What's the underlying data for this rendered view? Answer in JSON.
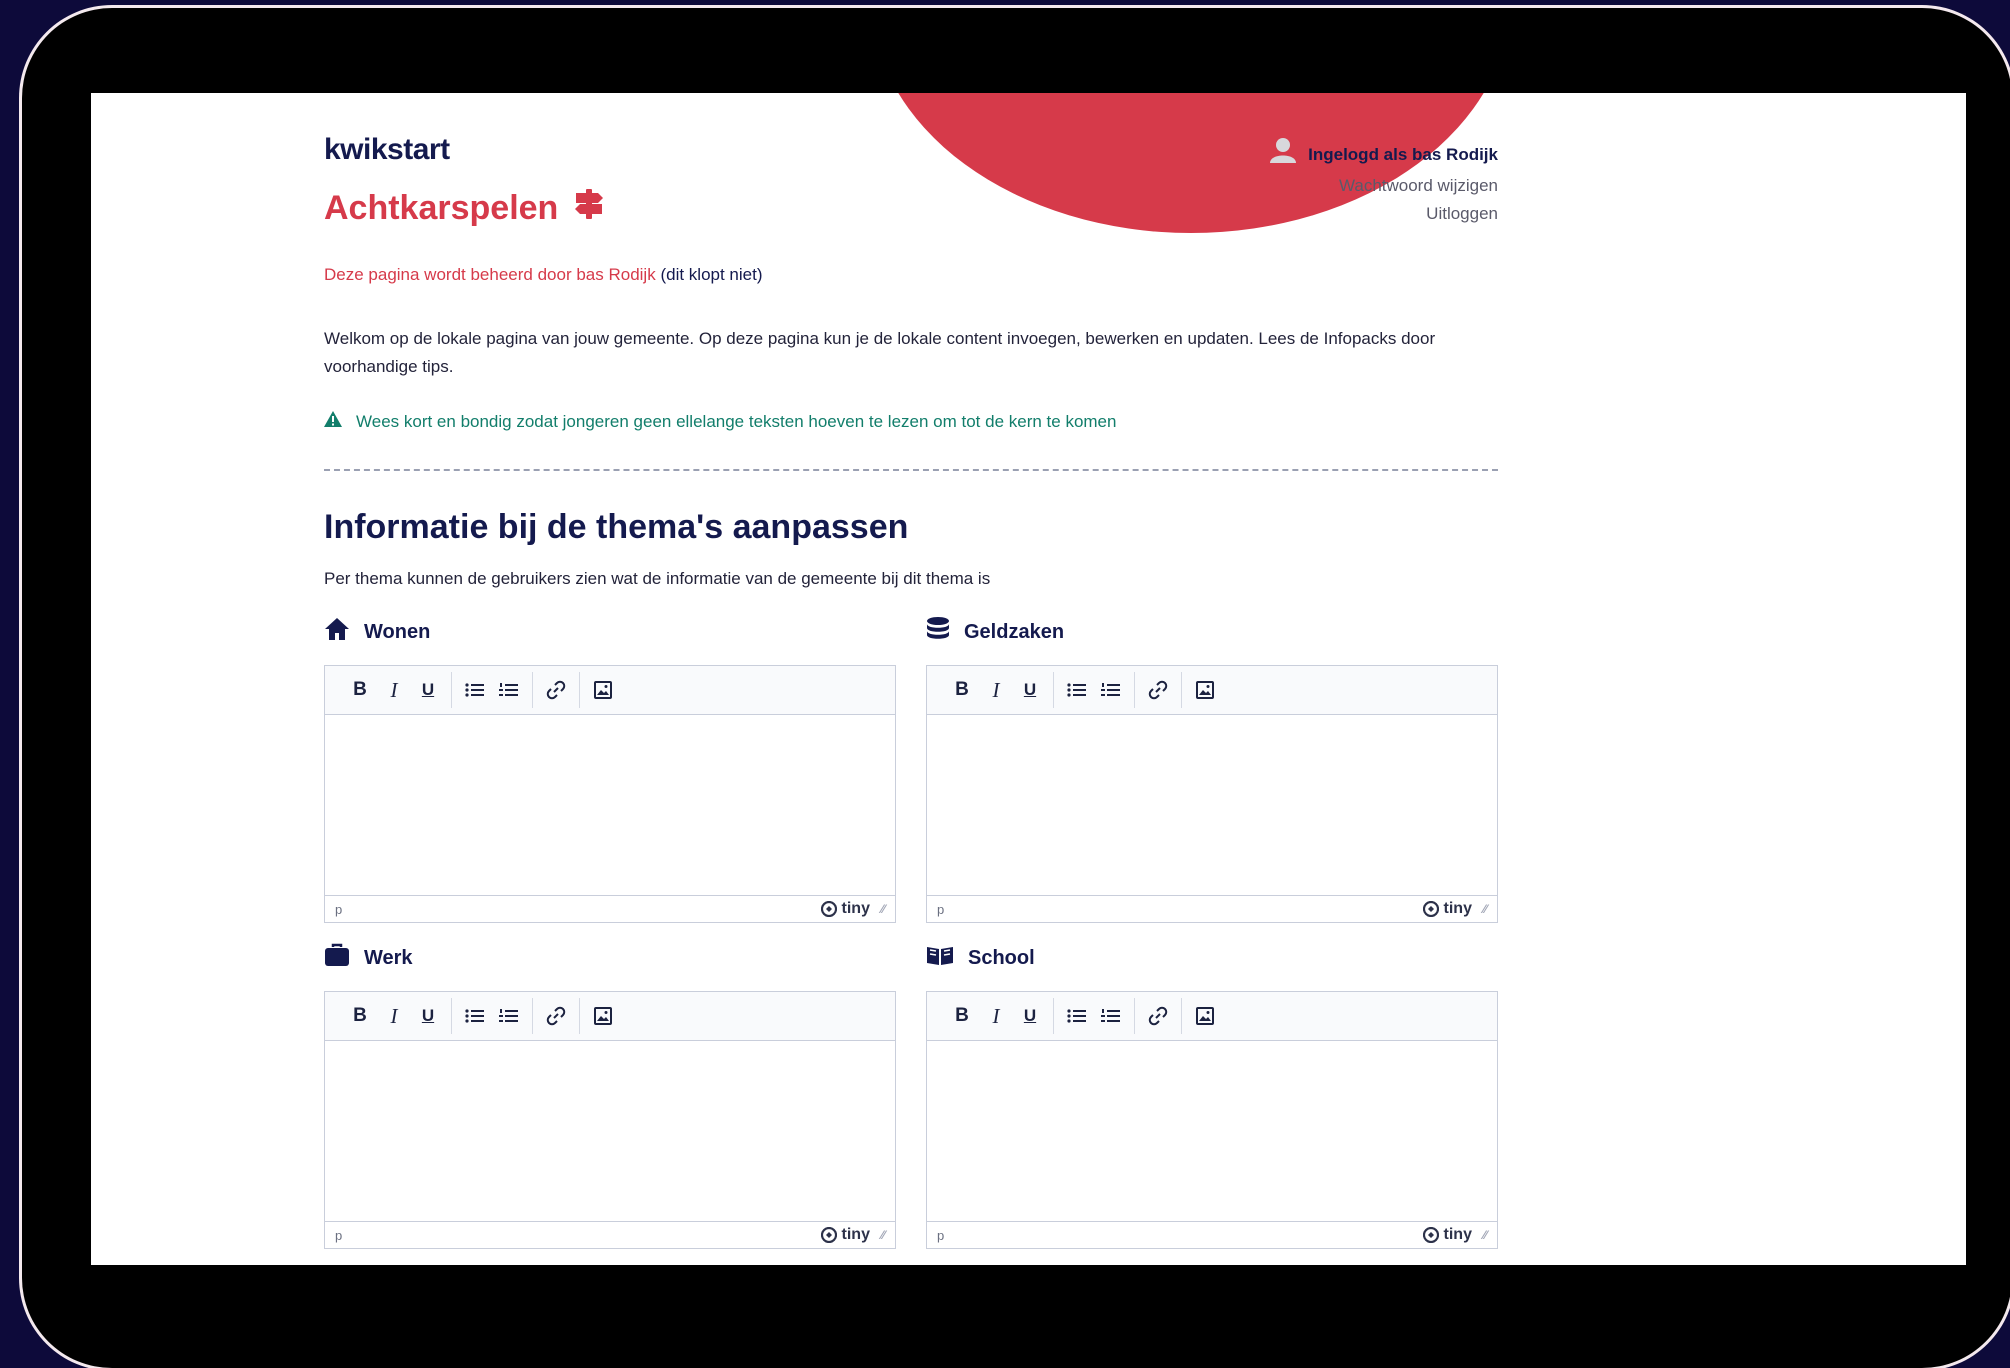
{
  "app": {
    "logo": "kwikstart"
  },
  "page": {
    "title": "Achtkarspelen",
    "title_icon": "signpost-icon"
  },
  "account": {
    "logged_in_as": "Ingelogd als bas Rodijk",
    "change_password": "Wachtwoord wijzigen",
    "logout": "Uitloggen"
  },
  "managed": {
    "text": "Deze pagina wordt beheerd door bas Rodijk",
    "dispute": "(dit klopt niet)"
  },
  "welcome": "Welkom op de lokale pagina van jouw gemeente. Op deze pagina kun je de lokale content invoegen, bewerken en updaten. Lees de Infopacks door voorhandige tips.",
  "tip": "Wees kort en bondig zodat jongeren geen ellelange teksten hoeven te lezen om tot de kern te komen",
  "section": {
    "title": "Informatie bij de thema's aanpassen",
    "subtitle": "Per thema kunnen de gebruikers zien wat de informatie van de gemeente bij dit thema is"
  },
  "editor": {
    "bold": "B",
    "italic": "I",
    "underline": "U",
    "status_path": "p",
    "brand": "tiny"
  },
  "themes": [
    {
      "name": "Wonen",
      "icon": "house-icon"
    },
    {
      "name": "Geldzaken",
      "icon": "coins-icon"
    },
    {
      "name": "Werk",
      "icon": "briefcase-icon"
    },
    {
      "name": "School",
      "icon": "book-icon"
    }
  ],
  "colors": {
    "brand_red": "#d63a4a",
    "navy": "#141a4e",
    "tip_green": "#127e6b",
    "background": "#0d0a3a"
  }
}
